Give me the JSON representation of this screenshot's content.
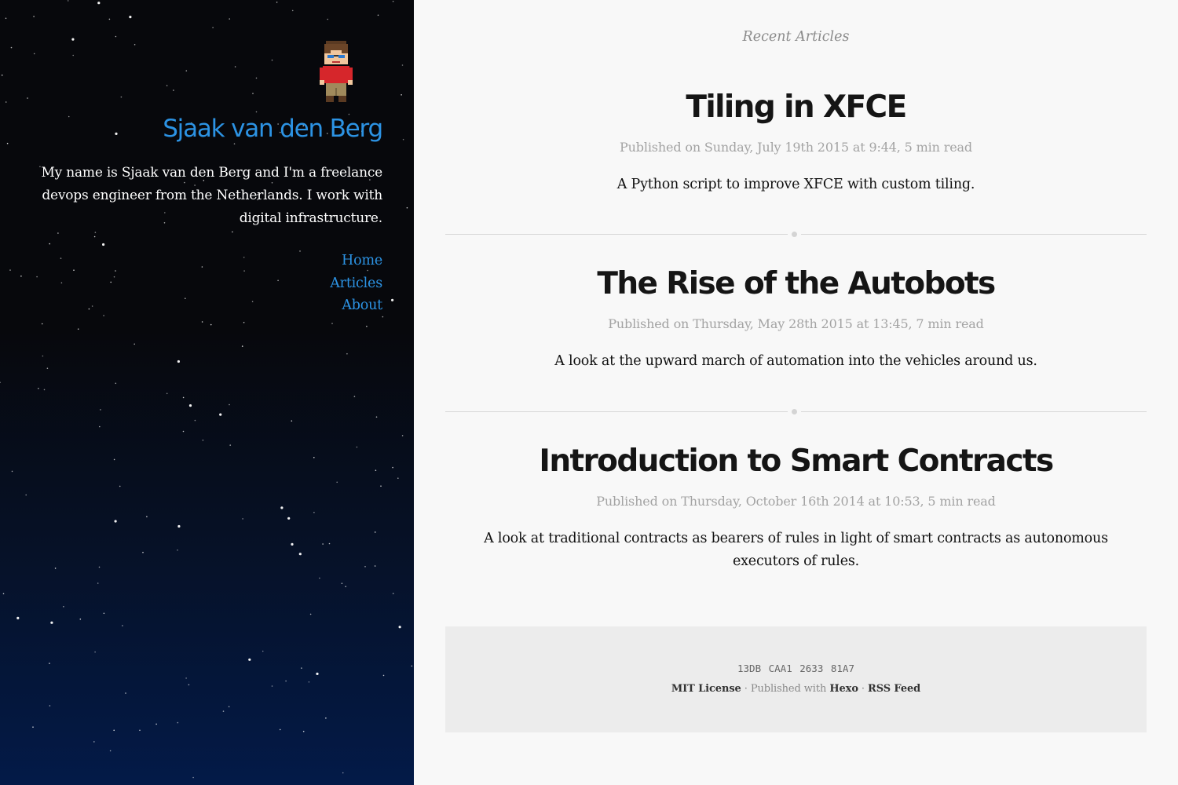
{
  "sidebar": {
    "avatar_icon": "pixel-avatar-icon",
    "title": "Sjaak van den Berg",
    "bio": "My name is Sjaak van den Berg and I'm a freelance devops engineer from the Netherlands. I work with digital infrastructure.",
    "nav": [
      {
        "label": "Home"
      },
      {
        "label": "Articles"
      },
      {
        "label": "About"
      }
    ]
  },
  "main": {
    "section_title": "Recent Articles",
    "articles": [
      {
        "title": "Tiling in XFCE",
        "meta": "Published on Sunday, July 19th 2015 at 9:44, 5 min read",
        "description": "A Python script to improve XFCE with custom tiling."
      },
      {
        "title": "The Rise of the Autobots",
        "meta": "Published on Thursday, May 28th 2015 at 13:45, 7 min read",
        "description": "A look at the upward march of automation into the vehicles around us."
      },
      {
        "title": "Introduction to Smart Contracts",
        "meta": "Published on Thursday, October 16th 2014 at 10:53, 5 min read",
        "description": "A look at traditional contracts as bearers of rules in light of smart contracts as autonomous executors of rules."
      }
    ]
  },
  "footer": {
    "fingerprint": "13DB CAA1 2633 81A7",
    "license": "MIT License",
    "separator": " · ",
    "published_with": "Published with",
    "hexo": "Hexo",
    "rss": "RSS Feed"
  },
  "colors": {
    "accent": "#2c93e4",
    "sidebar_top": "#07080c",
    "sidebar_bottom": "#031a48",
    "page_background": "#f8f8f8",
    "footer_background": "#ececec"
  }
}
